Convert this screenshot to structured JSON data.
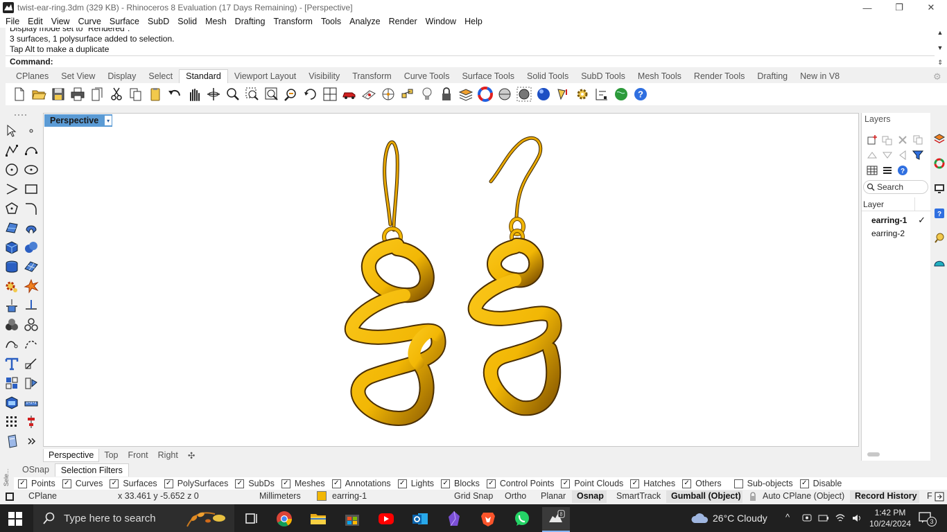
{
  "window": {
    "title": "twist-ear-ring.3dm (329 KB) - Rhinoceros 8 Evaluation (17 Days Remaining) - [Perspective]",
    "controls": {
      "minimize": "—",
      "restore": "❐",
      "close": "✕"
    }
  },
  "menu": [
    "File",
    "Edit",
    "View",
    "Curve",
    "Surface",
    "SubD",
    "Solid",
    "Mesh",
    "Drafting",
    "Transform",
    "Tools",
    "Analyze",
    "Render",
    "Window",
    "Help"
  ],
  "command": {
    "history": [
      "Display mode set to \"Rendered\".",
      "3 surfaces, 1 polysurface added to selection.",
      "Tap Alt to make a duplicate"
    ],
    "prompt_label": "Command:"
  },
  "toolbar_tabs": {
    "items": [
      "CPlanes",
      "Set View",
      "Display",
      "Select",
      "Standard",
      "Viewport Layout",
      "Visibility",
      "Transform",
      "Curve Tools",
      "Surface Tools",
      "Solid Tools",
      "SubD Tools",
      "Mesh Tools",
      "Render Tools",
      "Drafting",
      "New in V8"
    ],
    "active": "Standard"
  },
  "standard_toolbar_icons": [
    "new-icon",
    "open-icon",
    "save-icon",
    "print-icon",
    "import-icon",
    "cut-icon",
    "copy-icon",
    "paste-icon",
    "undo-icon",
    "pan-icon",
    "rotate-view-icon",
    "zoom-icon",
    "zoom-window-icon",
    "zoom-extents-icon",
    "zoom-selected-icon",
    "rotate-icon",
    "four-viewports-icon",
    "car-icon",
    "grid-icon",
    "cplane-icon",
    "points-icon",
    "light-icon",
    "lock-icon",
    "layer-icon",
    "color-wheel-icon",
    "shade-icon",
    "render-preview-icon",
    "material-sphere-icon",
    "options-pen-icon",
    "settings-gear-icon",
    "dimension-icon",
    "globe-icon",
    "help-icon"
  ],
  "viewport": {
    "title": "Perspective",
    "dropdown_icon": "▾",
    "tabs": [
      "Perspective",
      "Top",
      "Front",
      "Right"
    ],
    "active_tab": "Perspective",
    "add_tab_icon": "✣",
    "object_color": "#f2b705"
  },
  "layers_panel": {
    "title": "Layers",
    "search_placeholder": "Search",
    "column_header": "Layer",
    "rows": [
      {
        "name": "earring-1",
        "current": true,
        "check": "✓"
      },
      {
        "name": "earring-2",
        "current": false,
        "check": ""
      }
    ]
  },
  "panel_tabs": {
    "items": [
      "OSnap",
      "Selection Filters"
    ],
    "active": "Selection Filters",
    "side_label": "Sele..."
  },
  "selection_filters": [
    {
      "label": "Points",
      "checked": true
    },
    {
      "label": "Curves",
      "checked": true
    },
    {
      "label": "Surfaces",
      "checked": true
    },
    {
      "label": "PolySurfaces",
      "checked": true
    },
    {
      "label": "SubDs",
      "checked": true
    },
    {
      "label": "Meshes",
      "checked": true
    },
    {
      "label": "Annotations",
      "checked": true
    },
    {
      "label": "Lights",
      "checked": true
    },
    {
      "label": "Blocks",
      "checked": true
    },
    {
      "label": "Control Points",
      "checked": true
    },
    {
      "label": "Point Clouds",
      "checked": true
    },
    {
      "label": "Hatches",
      "checked": true
    },
    {
      "label": "Others",
      "checked": true
    },
    {
      "label": "Sub-objects",
      "checked": false
    },
    {
      "label": "Disable",
      "checked": true
    }
  ],
  "status_bar": {
    "cplane": "CPlane",
    "coords": "x 33.461   y -5.652   z 0",
    "units": "Millimeters",
    "layer": "earring-1",
    "grid_snap": "Grid Snap",
    "ortho": "Ortho",
    "planar": "Planar",
    "osnap": "Osnap",
    "smarttrack": "SmartTrack",
    "gumball": "Gumball (Object)",
    "auto_cplane": "Auto CPlane (Object)",
    "record_history": "Record History",
    "filter": "F",
    "layer_color": "#f2b705"
  },
  "taskbar": {
    "search_placeholder": "Type here to search",
    "weather": "26°C  Cloudy",
    "time": "1:42 PM",
    "date": "10/24/2024",
    "notifications": "3",
    "rhino_badge": "8"
  }
}
